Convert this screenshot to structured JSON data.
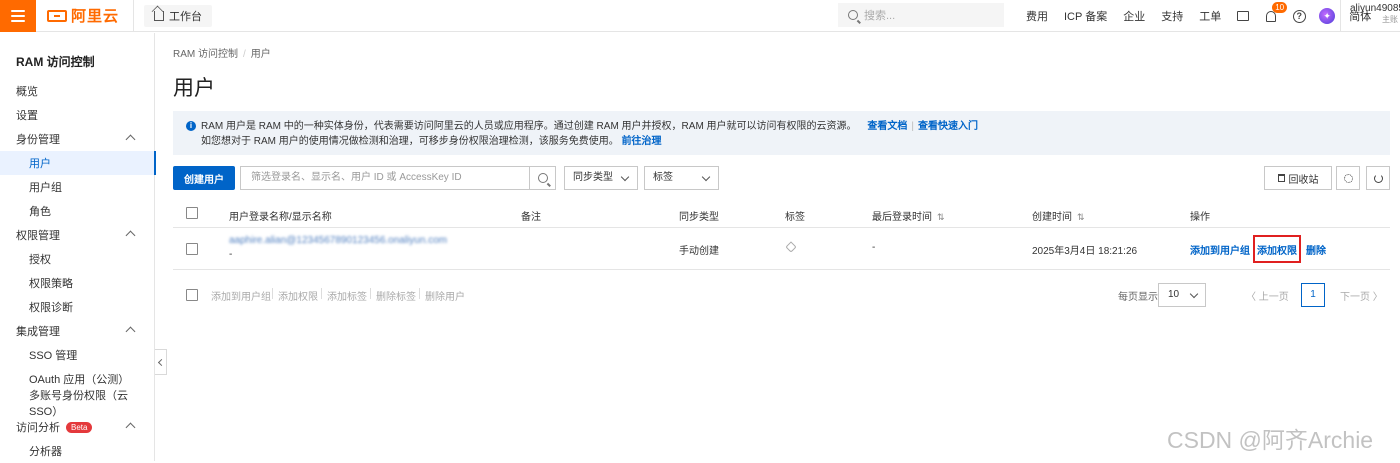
{
  "topbar": {
    "logo_text": "阿里云",
    "workbench_label": "工作台",
    "search_placeholder": "搜索...",
    "links": [
      "费用",
      "ICP 备案",
      "企业",
      "支持",
      "工单"
    ],
    "notification_count": "10",
    "language": "简体",
    "user_name": "aliyun49085",
    "user_role": "主账"
  },
  "sidebar": {
    "title": "RAM 访问控制",
    "items": [
      {
        "label": "概览"
      },
      {
        "label": "设置"
      },
      {
        "label": "身份管理"
      },
      {
        "label": "用户"
      },
      {
        "label": "用户组"
      },
      {
        "label": "角色"
      },
      {
        "label": "权限管理"
      },
      {
        "label": "授权"
      },
      {
        "label": "权限策略"
      },
      {
        "label": "权限诊断"
      },
      {
        "label": "集成管理"
      },
      {
        "label": "SSO 管理"
      },
      {
        "label": "OAuth 应用（公测）"
      },
      {
        "label": "多账号身份权限（云 SSO）"
      },
      {
        "label": "访问分析"
      },
      {
        "label": "分析器"
      }
    ],
    "beta_badge": "Beta"
  },
  "breadcrumb": {
    "root": "RAM 访问控制",
    "separator": "/",
    "current": "用户"
  },
  "page_title": "用户",
  "notice": {
    "line1": "RAM 用户是 RAM 中的一种实体身份，代表需要访问阿里云的人员或应用程序。通过创建 RAM 用户并授权，RAM 用户就可以访问有权限的云资源。",
    "link1": "查看文档",
    "link2": "查看快速入门",
    "line2": "如您想对于 RAM 用户的使用情况做检测和治理，可移步身份权限治理检测，该服务免费使用。",
    "link3": "前往治理"
  },
  "toolbar": {
    "create_label": "创建用户",
    "filter_placeholder": "筛选登录名、显示名、用户 ID 或 AccessKey ID",
    "sync_type_label": "同步类型",
    "tag_label": "标签",
    "recycle_label": "回收站"
  },
  "table": {
    "headers": {
      "name": "用户登录名称/显示名称",
      "remark": "备注",
      "sync_type": "同步类型",
      "tags": "标签",
      "last_login": "最后登录时间",
      "created": "创建时间",
      "actions": "操作"
    },
    "sort_glyph": "⇅",
    "rows": [
      {
        "login_name": "aaphire.alian@1234567890123456.onaliyun.com",
        "display_name": "-",
        "sync_type": "手动创建",
        "last_login": "-",
        "created": "2025年3月4日 18:21:26",
        "action_add_group": "添加到用户组",
        "action_add_perm": "添加权限",
        "action_delete": "删除"
      }
    ]
  },
  "bottom": {
    "batch_actions": [
      "添加到用户组",
      "添加权限",
      "添加标签",
      "删除标签",
      "删除用户"
    ],
    "per_page_label": "每页显示",
    "per_page_value": "10",
    "prev_label": "上一页",
    "current_page": "1",
    "next_label": "下一页"
  },
  "watermark": "CSDN @阿齐Archie",
  "colors": {
    "brand": "#ff6a00",
    "primary": "#0064c8",
    "highlight": "#e02020"
  }
}
